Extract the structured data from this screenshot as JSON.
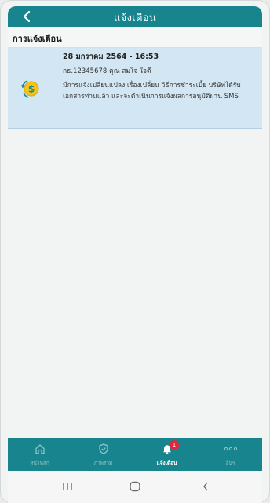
{
  "header": {
    "title": "แจ้งเตือน"
  },
  "section": {
    "title": "การแจ้งเตือน"
  },
  "notification": {
    "date": "28 มกราคม 2564 - 16:53",
    "sub": "กธ.12345678  คุณ สมใจ ใจดี",
    "body": "มีการแจ้งเปลี่ยนแปลง เรื่องเปลี่ยน วิธีการชำระเบี้ย บริษัทได้รับเอกสารท่านแล้ว และจะดำเนินการแจ้งผลการอนุมัติผ่าน SMS",
    "icon": "dollar-refresh-icon"
  },
  "nav": {
    "items": [
      {
        "label": "หน้าหลัก",
        "icon": "home-icon"
      },
      {
        "label": "ภาพรวม",
        "icon": "shield-check-icon"
      },
      {
        "label": "แจ้งเตือน",
        "icon": "bell-icon",
        "badge": "1",
        "active": true
      },
      {
        "label": "อื่นๆ",
        "icon": "more-dots-icon"
      }
    ]
  },
  "colors": {
    "primary": "#18848e",
    "highlight": "#d3e6f3",
    "badge": "#e2283a"
  }
}
